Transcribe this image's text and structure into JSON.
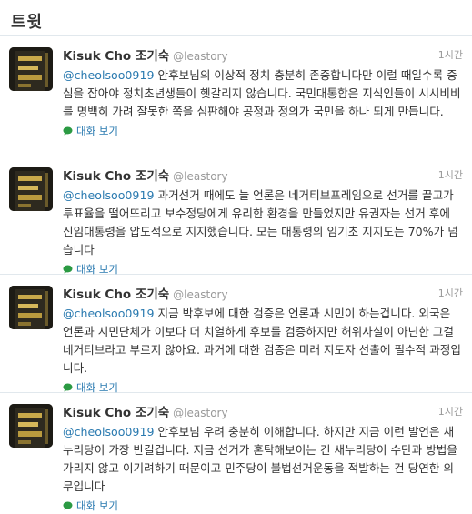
{
  "header": {
    "title": "트윗"
  },
  "tweets": [
    {
      "fullname": "Kisuk Cho 조기숙",
      "username": "@leastory",
      "time": "1시간",
      "mention": "@cheolsoo0919",
      "text": " 안후보님의 이상적 정치 충분히 존중합니다만 이럴 때일수록 중심을 잡아야 정치초년생들이 헷갈리지 않습니다. 국민대통합은 지식인들이 시시비비를 명백히 가려 잘못한 쪽을 심판해야 공정과 정의가 국민을 하나 되게 만듭니다.",
      "conversation": "대화 보기"
    },
    {
      "fullname": "Kisuk Cho 조기숙",
      "username": "@leastory",
      "time": "1시간",
      "mention": "@cheolsoo0919",
      "text": " 과거선거 때에도 늘 언론은 네거티브프레임으로 선거를 끌고가 투표율을 떨어뜨리고 보수정당에게 유리한 환경을 만들었지만 유권자는 선거 후에 신임대통령을 압도적으로 지지했습니다. 모든 대통령의 임기초 지지도는 70%가 넘습니다",
      "conversation": "대화 보기"
    },
    {
      "fullname": "Kisuk Cho 조기숙",
      "username": "@leastory",
      "time": "1시간",
      "mention": "@cheolsoo0919",
      "text": " 지금 박후보에 대한 검증은 언론과 시민이 하는겁니다. 외국은 언론과 시민단체가 이보다 더 치열하게 후보를 검증하지만 허위사실이 아닌한 그걸 네거티브라고 부르지 않아요. 과거에 대한 검증은 미래 지도자 선출에 필수적 과정입니다.",
      "conversation": "대화 보기"
    },
    {
      "fullname": "Kisuk Cho 조기숙",
      "username": "@leastory",
      "time": "1시간",
      "mention": "@cheolsoo0919",
      "text": " 안후보님 우려 충분히 이해합니다. 하지만 지금 이런 발언은 새누리당이 가장 반길겁니다. 지금 선거가 혼탁해보이는 건 새누리당이 수단과 방법을 가리지 않고 이기려하기 때문이고 민주당이 불법선거운동을 적발하는 건 당연한 의무입니다",
      "conversation": "대화 보기"
    }
  ]
}
